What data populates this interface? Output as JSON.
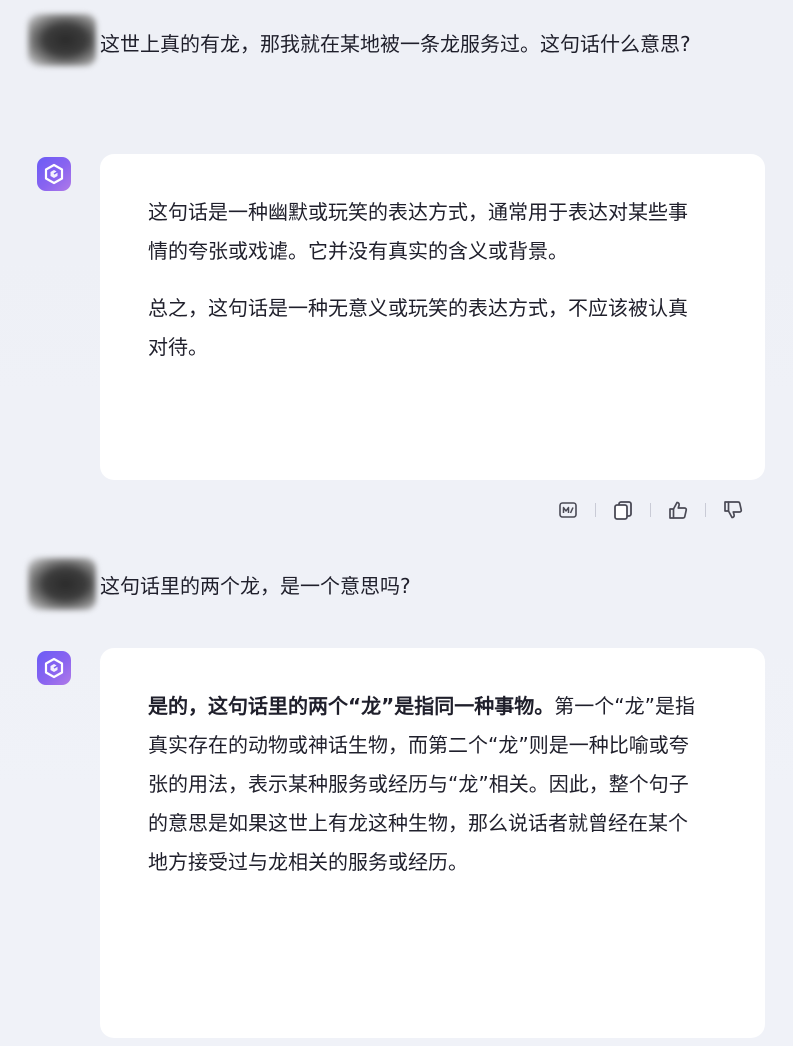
{
  "conversation": {
    "messages": [
      {
        "role": "user",
        "text": "这世上真的有龙，那我就在某地被一条龙服务过。这句话什么意思?"
      },
      {
        "role": "assistant",
        "paragraphs": [
          "这句话是一种幽默或玩笑的表达方式，通常用于表达对某些事情的夸张或戏谑。它并没有真实的含义或背景。",
          "总之，这句话是一种无意义或玩笑的表达方式，不应该被认真对待。"
        ]
      },
      {
        "role": "user",
        "text": "这句话里的两个龙，是一个意思吗?"
      },
      {
        "role": "assistant",
        "bold_lead": "是的，这句话里的两个“龙”是指同一种事物。",
        "body": "第一个“龙”是指真实存在的动物或神话生物，而第二个“龙”则是一种比喻或夸张的用法，表示某种服务或经历与“龙”相关。因此，整个句子的意思是如果这世上有龙这种生物，那么说话者就曾经在某个地方接受过与龙相关的服务或经历。"
      }
    ]
  },
  "actions": {
    "icons": [
      "mindmap-icon",
      "copy-icon",
      "thumbs-up-icon",
      "thumbs-down-icon"
    ],
    "icon_color": "#4a4a55"
  },
  "colors": {
    "background": "#eef0f6",
    "bubble": "#ffffff",
    "bot_avatar": "#7b62f2",
    "text": "#1f1f2b"
  }
}
